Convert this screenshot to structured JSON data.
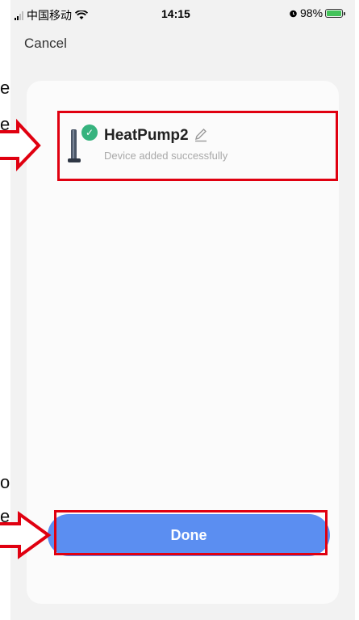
{
  "status_bar": {
    "carrier": "中国移动",
    "time": "14:15",
    "battery": "98%",
    "battery_level": 0.98
  },
  "nav": {
    "cancel_label": "Cancel"
  },
  "device": {
    "name": "HeatPump2",
    "status": "Device added successfully"
  },
  "footer": {
    "done_label": "Done"
  },
  "overlay_text": {
    "line1": "e",
    "line2": "e",
    "line3": "o",
    "line4": "e"
  },
  "colors": {
    "annotation_red": "#e00010",
    "done_button_blue": "#5b8ef1",
    "success_green": "#36b37e"
  }
}
